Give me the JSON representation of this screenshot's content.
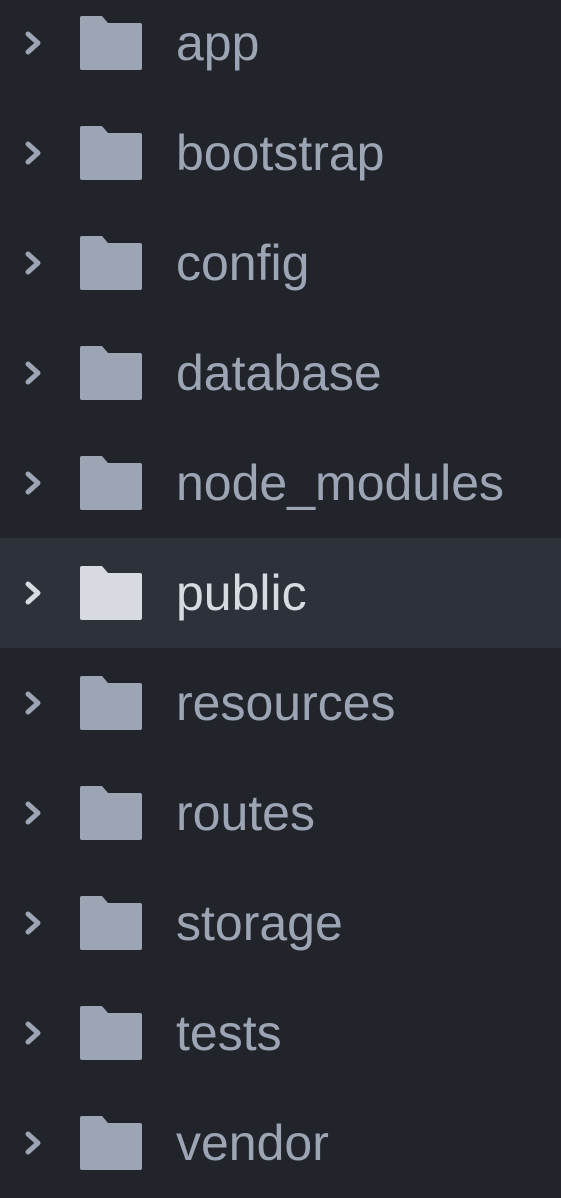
{
  "tree": {
    "items": [
      {
        "label": "app"
      },
      {
        "label": "bootstrap"
      },
      {
        "label": "config"
      },
      {
        "label": "database"
      },
      {
        "label": "node_modules"
      },
      {
        "label": "public",
        "selected": true
      },
      {
        "label": "resources"
      },
      {
        "label": "routes"
      },
      {
        "label": "storage"
      },
      {
        "label": "tests"
      },
      {
        "label": "vendor"
      }
    ],
    "icons": {
      "expander": "chevron-right-icon",
      "folder": "folder-icon"
    },
    "colors": {
      "background": "#21252b",
      "selected_row": "#2c313a",
      "text": "#9da5b4",
      "text_selected": "#d7dae0",
      "folder": "#9da5b4",
      "folder_selected": "#d7dae0"
    }
  }
}
